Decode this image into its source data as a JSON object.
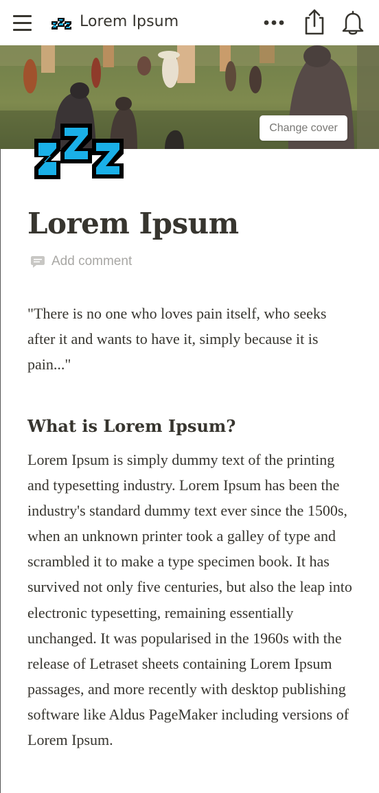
{
  "topbar": {
    "title": "Lorem Ipsum",
    "menu_icon": "hamburger-menu-icon",
    "page_icon": "zzz-sleeping-icon",
    "more_icon": "more-horizontal-icon",
    "share_icon": "share-icon",
    "bell_icon": "bell-icon"
  },
  "cover": {
    "change_cover_label": "Change cover"
  },
  "page": {
    "title": "Lorem Ipsum",
    "add_comment_label": "Add comment",
    "quote": "\"There is no one who loves pain itself, who seeks after it and wants to have it, simply because it is pain...\"",
    "heading": "What is Lorem Ipsum?",
    "paragraph": "Lorem Ipsum is simply dummy text of the printing and typesetting industry. Lorem Ipsum has been the industry's standard dummy text ever since the 1500s, when an unknown printer took a galley of type and scrambled it to make a type specimen book. It has survived not only five centuries, but also the leap into electronic typesetting, remaining essentially unchanged. It was popularised in the 1960s with the release of Letraset sheets containing Lorem Ipsum passages, and more recently with desktop publishing software like Aldus PageMaker including versions of Lorem Ipsum."
  },
  "colors": {
    "text": "#37352f",
    "muted": "#a8a7a4",
    "zzz_fill": "#1ab0e8"
  }
}
